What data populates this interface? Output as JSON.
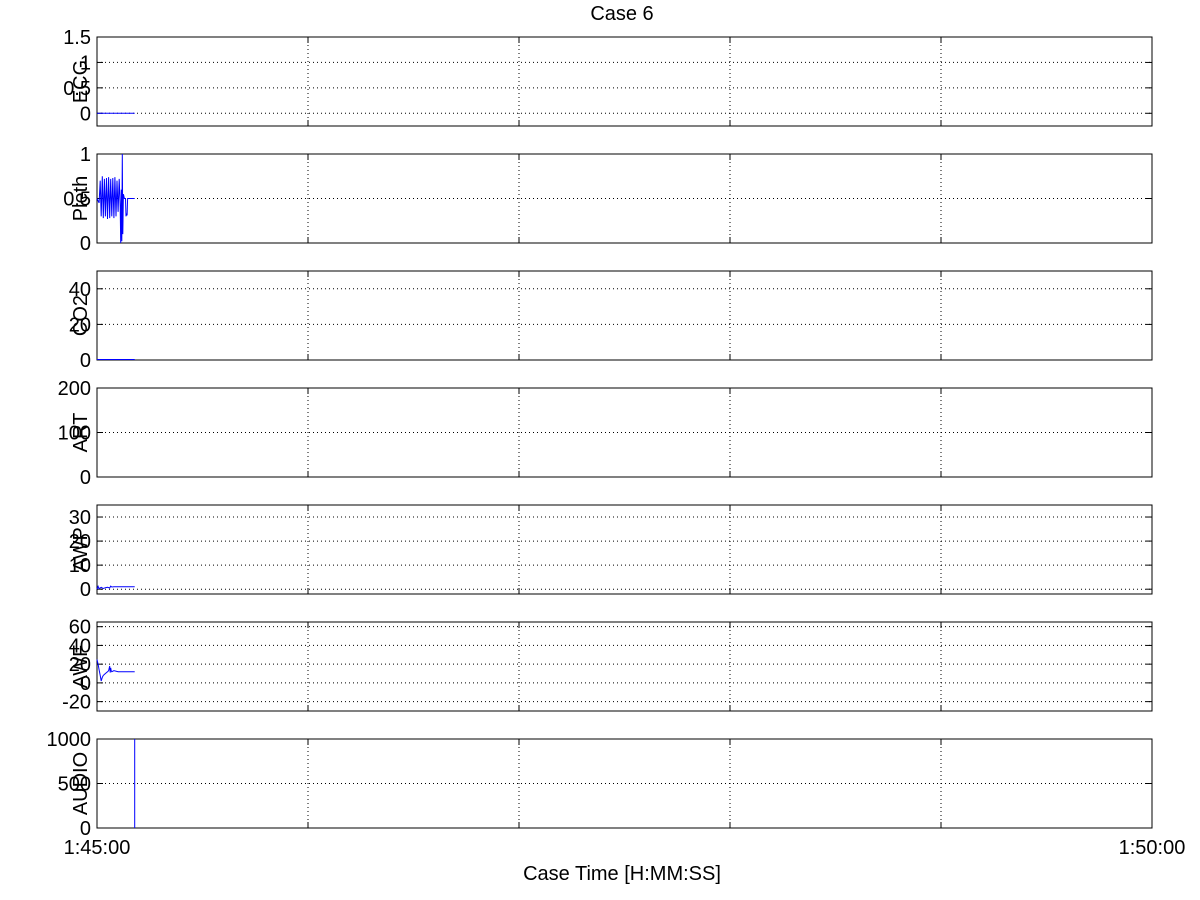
{
  "title": "Case 6",
  "xlabel": "Case Time [H:MM:SS]",
  "colors": {
    "line": "#0000ff",
    "axis": "#000000",
    "grid": "#000000",
    "background": "#ffffff"
  },
  "chart_data": [
    {
      "type": "line",
      "ylabel": "ECG",
      "ylim": [
        -0.25,
        1.5
      ],
      "yticks": [
        0,
        0.5,
        1,
        1.5
      ],
      "ytick_labels": [
        "0",
        "0.5",
        "1",
        "1.5"
      ],
      "grid": true,
      "series": [
        {
          "x": [
            0,
            0.0357
          ],
          "y": [
            0,
            0
          ]
        }
      ]
    },
    {
      "type": "line",
      "ylabel": "Pleth",
      "ylim": [
        0,
        1
      ],
      "yticks": [
        0,
        0.5,
        1
      ],
      "ytick_labels": [
        "0",
        "0.5",
        "1"
      ],
      "grid": true,
      "series": [
        {
          "x": [
            0,
            0.002,
            0.003,
            0.004,
            0.005,
            0.006,
            0.007,
            0.008,
            0.009,
            0.01,
            0.011,
            0.012,
            0.013,
            0.014,
            0.015,
            0.016,
            0.017,
            0.018,
            0.019,
            0.02,
            0.021,
            0.022,
            0.0225,
            0.023,
            0.0235,
            0.024,
            0.0245,
            0.025,
            0.026,
            0.027,
            0.0275,
            0.028,
            0.0285,
            0.029,
            0.0357
          ],
          "y": [
            0.5,
            0.45,
            0.7,
            0.3,
            0.75,
            0.28,
            0.72,
            0.3,
            0.73,
            0.27,
            0.74,
            0.28,
            0.72,
            0.3,
            0.73,
            0.28,
            0.74,
            0.3,
            0.7,
            0.35,
            0.72,
            0.4,
            0.0,
            0.6,
            0.02,
            1.0,
            0.1,
            0.55,
            0.5,
            0.5,
            0.3,
            0.33,
            0.31,
            0.5,
            0.5
          ]
        }
      ]
    },
    {
      "type": "line",
      "ylabel": "CO2",
      "ylim": [
        0,
        50
      ],
      "yticks": [
        0,
        20,
        40
      ],
      "ytick_labels": [
        "0",
        "20",
        "40"
      ],
      "grid": true,
      "series": [
        {
          "x": [
            0,
            0.0357
          ],
          "y": [
            0.3,
            0.3
          ]
        }
      ]
    },
    {
      "type": "line",
      "ylabel": "ART",
      "ylim": [
        0,
        200
      ],
      "yticks": [
        0,
        100,
        200
      ],
      "ytick_labels": [
        "0",
        "100",
        "200"
      ],
      "grid": true,
      "series": []
    },
    {
      "type": "line",
      "ylabel": "AWP",
      "ylim": [
        -2,
        35
      ],
      "yticks": [
        0,
        10,
        20,
        30
      ],
      "ytick_labels": [
        "0",
        "10",
        "20",
        "30"
      ],
      "grid": true,
      "series": [
        {
          "x": [
            0,
            0.001,
            0.002,
            0.004,
            0.006,
            0.008,
            0.01,
            0.012,
            0.013,
            0.014,
            0.016,
            0.02,
            0.0357
          ],
          "y": [
            0,
            1.2,
            0.2,
            0.8,
            0.3,
            0.6,
            0.8,
            0.5,
            1.3,
            0.9,
            1.0,
            1.0,
            1.0
          ]
        }
      ]
    },
    {
      "type": "line",
      "ylabel": "AWF",
      "ylim": [
        -30,
        65
      ],
      "yticks": [
        -20,
        0,
        20,
        40,
        60
      ],
      "ytick_labels": [
        "-20",
        "0",
        "20",
        "40",
        "60"
      ],
      "grid": true,
      "series": [
        {
          "x": [
            0,
            0.001,
            0.002,
            0.003,
            0.004,
            0.005,
            0.006,
            0.008,
            0.01,
            0.011,
            0.012,
            0.0125,
            0.013,
            0.0135,
            0.014,
            0.016,
            0.02,
            0.0357
          ],
          "y": [
            25,
            20,
            14,
            8,
            2,
            6,
            8,
            10,
            12,
            13,
            18,
            11,
            16,
            13,
            12,
            13,
            12,
            12
          ]
        }
      ]
    },
    {
      "type": "line",
      "ylabel": "AUDIO",
      "ylim": [
        0,
        1000
      ],
      "yticks": [
        0,
        500,
        1000
      ],
      "ytick_labels": [
        "0",
        "500",
        "1000"
      ],
      "grid": true,
      "series": [
        {
          "x": [
            0.0357,
            0.0357
          ],
          "y": [
            0,
            1000
          ]
        }
      ]
    }
  ],
  "xaxis": {
    "range": [
      "1:45:00",
      "1:50:00"
    ],
    "grid_fractions": [
      0.2,
      0.4,
      0.6,
      0.8
    ],
    "tick_labels": [
      "1:45:00",
      "1:50:00"
    ]
  }
}
